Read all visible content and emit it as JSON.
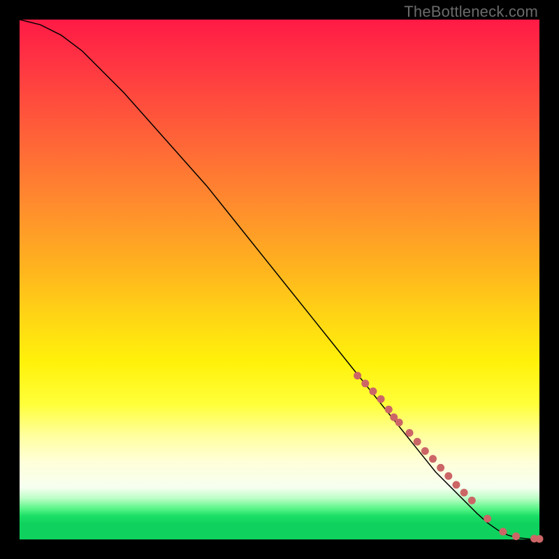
{
  "watermark": "TheBottleneck.com",
  "colors": {
    "dot": "#cc6666",
    "curve": "#000000",
    "frame": "#000000"
  },
  "chart_data": {
    "type": "line",
    "title": "",
    "xlabel": "",
    "ylabel": "",
    "xlim": [
      0,
      100
    ],
    "ylim": [
      0,
      100
    ],
    "grid": false,
    "legend": false,
    "series": [
      {
        "name": "bottleneck-curve",
        "x": [
          0,
          4,
          8,
          12,
          16,
          20,
          24,
          28,
          32,
          36,
          40,
          44,
          48,
          52,
          56,
          60,
          64,
          68,
          72,
          76,
          80,
          84,
          88,
          90,
          92,
          94,
          96,
          98,
          100
        ],
        "y": [
          100,
          99,
          97,
          94,
          90,
          86,
          81.5,
          77,
          72.5,
          68,
          63,
          58,
          53,
          48,
          43,
          38,
          33,
          28,
          23,
          18,
          13,
          9,
          5,
          3.2,
          1.8,
          0.8,
          0.3,
          0.1,
          0.05
        ]
      }
    ],
    "scatter": [
      {
        "name": "highlighted-points",
        "x": [
          65,
          66.5,
          68,
          69.5,
          71,
          72,
          73,
          75,
          76.5,
          78,
          79.5,
          81,
          82.5,
          84,
          85.5,
          87,
          90,
          93,
          95.5,
          99,
          100
        ],
        "y": [
          31.5,
          30,
          28.5,
          27,
          25,
          23.5,
          22.5,
          20.5,
          18.8,
          17,
          15.5,
          13.8,
          12.2,
          10.5,
          9,
          7.5,
          4,
          1.5,
          0.6,
          0.15,
          0.1
        ],
        "r": [
          5.5,
          5.5,
          5.5,
          5.5,
          5.5,
          5.5,
          5.5,
          5.5,
          5.5,
          5.5,
          5.5,
          5.5,
          5.5,
          5.5,
          5.5,
          5.5,
          5.5,
          5.5,
          5.5,
          5.5,
          5.5
        ]
      }
    ]
  }
}
